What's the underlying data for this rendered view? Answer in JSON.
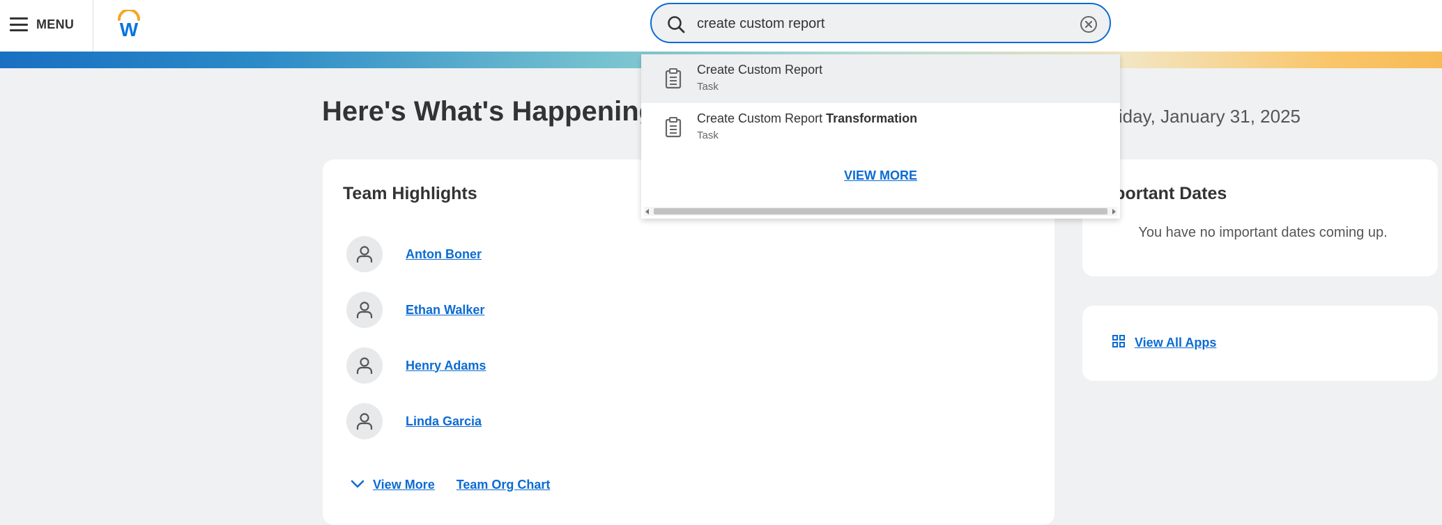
{
  "header": {
    "menu_label": "MENU",
    "logo_letter": "W"
  },
  "search": {
    "value": "create custom report",
    "results": [
      {
        "title": "Create Custom Report",
        "title_bold": "",
        "type": "Task"
      },
      {
        "title": "Create Custom Report ",
        "title_bold": "Transformation",
        "type": "Task"
      }
    ],
    "view_more": "VIEW MORE"
  },
  "page": {
    "title": "Here's What's Happening",
    "date": "Friday, January 31, 2025"
  },
  "team_highlights": {
    "title": "Team Highlights",
    "members": [
      "Anton Boner",
      "Ethan Walker",
      "Henry Adams",
      "Linda Garcia"
    ],
    "view_more": "View More",
    "org_chart": "Team Org Chart"
  },
  "important_dates": {
    "title": "Important Dates",
    "empty_message": "You have no important dates coming up."
  },
  "apps": {
    "view_all": "View All Apps"
  },
  "colors": {
    "accent": "#0b6bd3",
    "brand_orange": "#f5a623",
    "brand_blue": "#0875e1"
  }
}
